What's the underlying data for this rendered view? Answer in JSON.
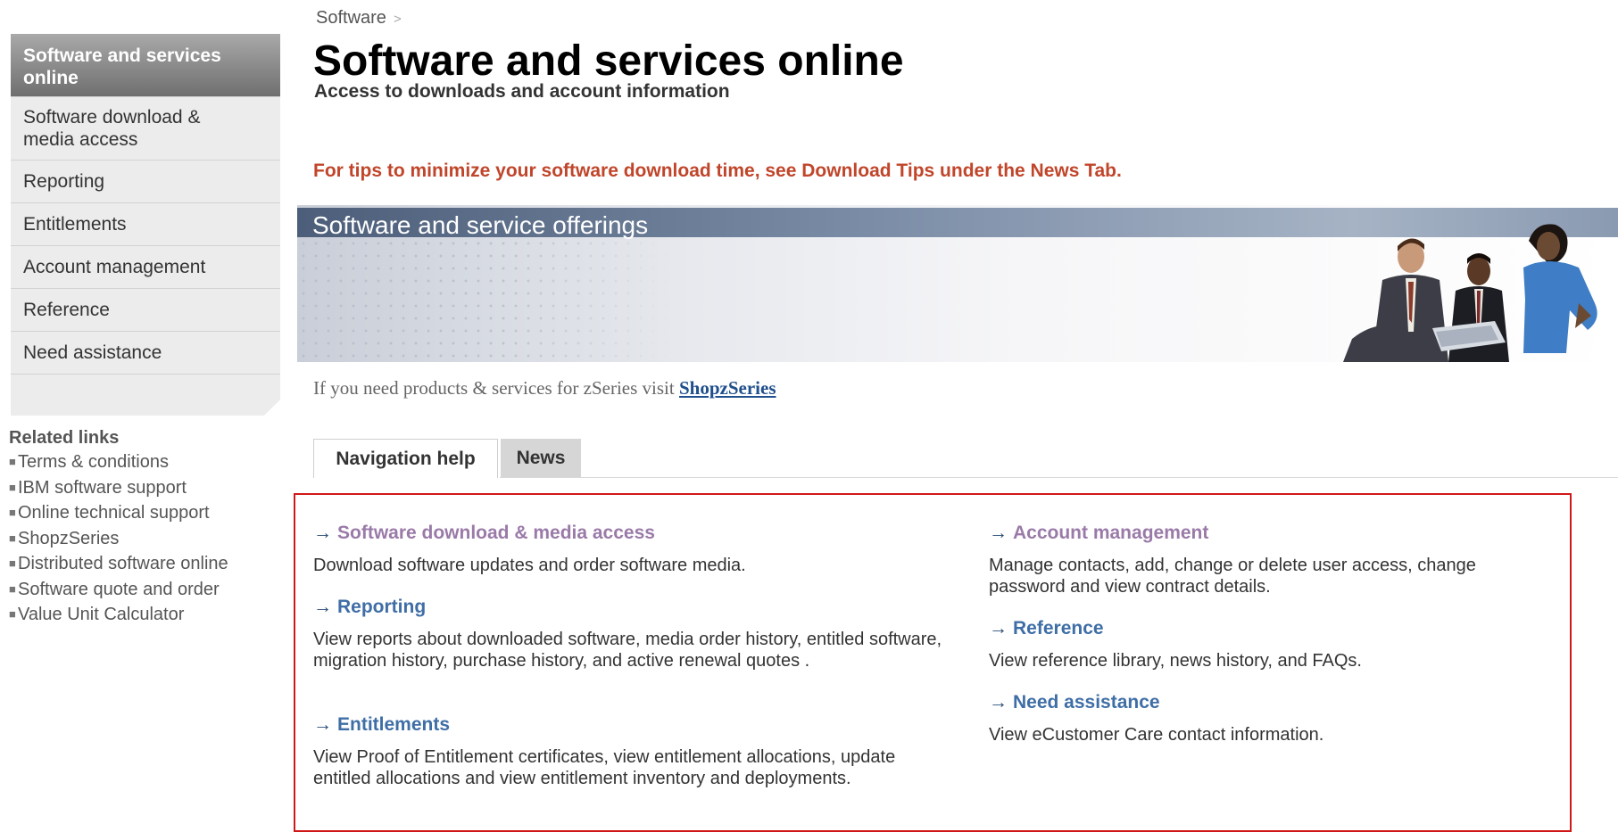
{
  "breadcrumb": {
    "item": "Software",
    "separator": ">"
  },
  "page": {
    "title": "Software and services online",
    "subtitle": "Access to downloads and account information",
    "tip": "For tips to minimize your software download time, see Download Tips under the News Tab."
  },
  "sidebar": {
    "active": "Software and services online",
    "items": [
      {
        "label": "Software download & media access"
      },
      {
        "label": "Reporting"
      },
      {
        "label": "Entitlements"
      },
      {
        "label": "Account management"
      },
      {
        "label": "Reference"
      },
      {
        "label": "Need assistance"
      }
    ]
  },
  "related": {
    "title": "Related links",
    "links": [
      "Terms & conditions",
      "IBM software support",
      "Online technical support",
      "ShopzSeries",
      "Distributed software online",
      "Software quote and order",
      "Value Unit Calculator"
    ]
  },
  "banner": {
    "title": "Software and service offerings"
  },
  "zseries": {
    "text": "If you need products & services for zSeries visit",
    "link": "ShopzSeries"
  },
  "tabs": [
    {
      "label": "Navigation help",
      "active": true
    },
    {
      "label": "News",
      "active": false
    }
  ],
  "help": {
    "arrow": "→",
    "left": [
      {
        "title": "Software download & media access",
        "desc": "Download software updates and order software media."
      },
      {
        "title": "Reporting",
        "desc": "View reports about downloaded software, media order history, entitled software, migration history, purchase history, and active renewal quotes ."
      },
      {
        "title": "Entitlements",
        "desc": "View Proof of Entitlement certificates, view entitlement allocations, update entitled allocations and view entitlement inventory and deployments."
      }
    ],
    "right": [
      {
        "title": "Account management",
        "desc": "Manage contacts, add, change or delete user access, change password and view contract details."
      },
      {
        "title": "Reference",
        "desc": "View reference library, news history, and FAQs."
      },
      {
        "title": "Need assistance",
        "desc": "View eCustomer Care contact information."
      }
    ]
  },
  "colors": {
    "tip": "#c0452a",
    "link": "#3f6ea6",
    "visited_link": "#9a7aa8",
    "highlight_border": "#d11818"
  }
}
